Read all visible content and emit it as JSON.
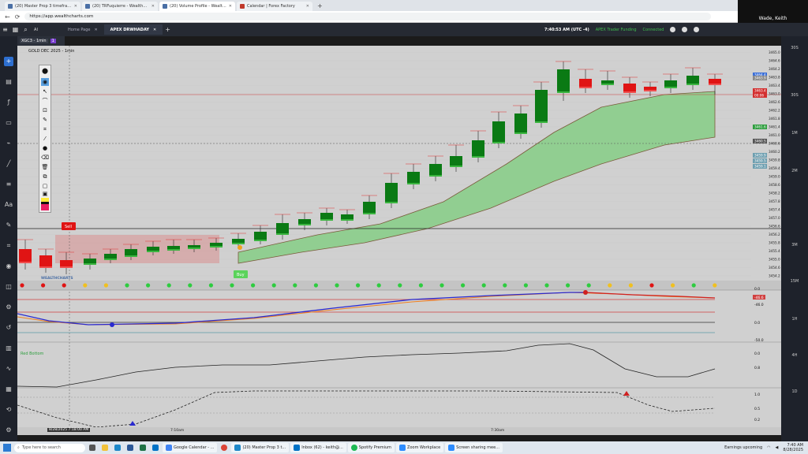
{
  "browser": {
    "tabs": [
      {
        "label": "(20) Master Prop 3 timeframes -",
        "active": false
      },
      {
        "label": "(20) TRFuquierre - WealthCharts",
        "active": false
      },
      {
        "label": "(20) Volume Profile - WealthCha",
        "active": true
      },
      {
        "label": "Calendar | Forex Factory",
        "active": false
      }
    ],
    "url": "https://app.wealthcharts.com"
  },
  "zoom": {
    "participant": "Wade, Keith"
  },
  "app": {
    "tabs": [
      {
        "label": "Home Page"
      },
      {
        "label": "APEX DRWHADAY"
      }
    ],
    "clock": "7:40:53 AM  (UTC -4)",
    "account": "APEX Trader Funding",
    "connection": "Connected",
    "symbol": "XGC3 - 1min",
    "symbol_sub": "1",
    "chart_title": "GOLD DEC 2025 - 1min"
  },
  "timeframes": [
    "30S",
    "30S",
    "1M",
    "2M",
    "3M",
    "15M",
    "1H",
    "4H",
    "1D"
  ],
  "prices": [
    "3465.0",
    "3464.6",
    "3464.2",
    "3463.8",
    "3463.4",
    "3463.0",
    "3462.6",
    "3462.2",
    "3461.8",
    "3461.4",
    "3461.0",
    "3460.6",
    "3460.2",
    "3459.8",
    "3459.4",
    "3459.0",
    "3458.6",
    "3458.2",
    "3457.8",
    "3457.4",
    "3457.0",
    "3456.6",
    "3456.2",
    "3455.8",
    "3455.4",
    "3455.0",
    "3454.6",
    "3454.2"
  ],
  "price_tags": [
    {
      "label": "3464.4",
      "color": "#3b6fd8"
    },
    {
      "label": "3463.9",
      "color": "#8a8a8a"
    },
    {
      "label": "3463.4",
      "color": "#d32f2f"
    },
    {
      "label": "00:06",
      "color": "#d32f2f"
    },
    {
      "label": "3461.6",
      "color": "#2e9e3e"
    },
    {
      "label": "3460.5",
      "color": "#555555"
    },
    {
      "label": "3459.9",
      "color": "#6e9fb0"
    },
    {
      "label": "3459.5",
      "color": "#6e9fb0"
    },
    {
      "label": "3459.1",
      "color": "#6e9fb0"
    }
  ],
  "sell_label": "Sell",
  "buy_label": "Buy",
  "logo": "WEALTHCHARTS",
  "indicator2": {
    "values": [
      "0.0",
      "-46.0",
      "0.0",
      "-50.0"
    ],
    "tag": "-46.6"
  },
  "indicator3": {
    "label": "Red Bottom",
    "values": [
      "0.0",
      "0.8"
    ]
  },
  "indicator4": {
    "values": [
      "1.0",
      "0.5",
      "0.2"
    ]
  },
  "crosshair_time": "8/28/2025 7:18:00 AM",
  "time_labels": [
    "7:10am",
    "7:30am"
  ],
  "taskbar": {
    "search": "Type here to search",
    "apps": [
      {
        "label": "Google Calendar - ..."
      },
      {
        "label": "(20) Master Prop 3 t..."
      },
      {
        "label": "Inbox (62) - keith@..."
      },
      {
        "label": "Spotify Premium"
      },
      {
        "label": "Zoom Workplace"
      },
      {
        "label": "Screen sharing mee..."
      }
    ],
    "weather": "Earnings upcoming",
    "time": "7:40 AM",
    "date": "8/28/2025"
  },
  "colors": {
    "bull": "#0a7a14",
    "bear": "#e01414",
    "band": "#7ccd7c",
    "chart_bg": "#d0d0d0"
  }
}
